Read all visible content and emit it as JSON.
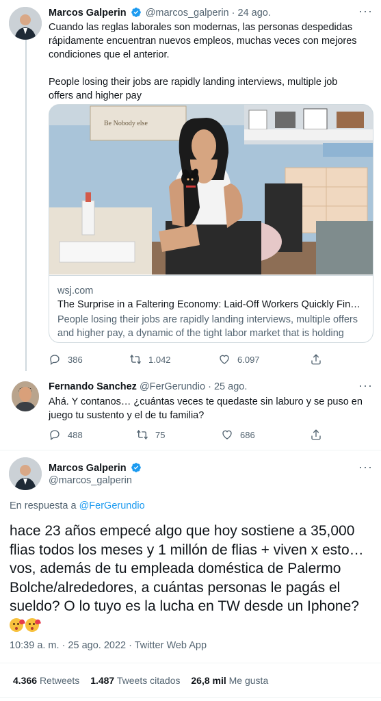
{
  "tweet1": {
    "name": "Marcos Galperin",
    "handle": "@marcos_galperin",
    "separator": "·",
    "date": "24 ago.",
    "text_es": "Cuando las reglas laborales son modernas, las personas despedidas rápidamente encuentran nuevos empleos, muchas veces con mejores condiciones que el anterior.",
    "text_en": "People losing their jobs are rapidly landing interviews, multiple job offers and higher pay",
    "card": {
      "domain": "wsj.com",
      "title": "The Surprise in a Faltering Economy: Laid-Off Workers Quickly Find Jo…",
      "description": "People losing their jobs are rapidly landing interviews, multiple offers and higher pay, a dynamic of the tight labor market that is holding do…",
      "image_sign": "Be Nobody else"
    },
    "actions": {
      "replies": "386",
      "retweets": "1.042",
      "likes": "6.097"
    }
  },
  "tweet2": {
    "name": "Fernando Sanchez",
    "handle": "@FerGerundio",
    "separator": "·",
    "date": "25 ago.",
    "text": "Ahá. Y contanos… ¿cuántas veces te quedaste sin laburo y se puso en juego tu sustento y el de tu familia?",
    "actions": {
      "replies": "488",
      "retweets": "75",
      "likes": "686"
    }
  },
  "main_tweet": {
    "name": "Marcos Galperin",
    "handle": "@marcos_galperin",
    "reply_prefix": "En respuesta a",
    "reply_mention": "@FerGerundio",
    "text": "hace 23 años empecé algo que hoy sostiene a 35,000 flias todos los meses y 1 millón de flias + viven x esto…vos, además de tu empleada doméstica de Palermo Bolche/alrededores, a cuántas personas le pagás el sueldo? O lo tuyo es la lucha en TW desde un Iphone?",
    "emojis": [
      "face-blowing-kiss",
      "face-blowing-kiss"
    ],
    "timestamp": "10:39 a. m. · 25 ago. 2022 · Twitter Web App",
    "stats": {
      "retweets_count": "4.366",
      "retweets_label": "Retweets",
      "quotes_count": "1.487",
      "quotes_label": "Tweets citados",
      "likes_count": "26,8 mil",
      "likes_label": "Me gusta"
    }
  },
  "more_label": "···",
  "colors": {
    "accent": "#1d9bf0",
    "text": "#0f1419",
    "muted": "#536471",
    "border": "#cfd9de"
  }
}
